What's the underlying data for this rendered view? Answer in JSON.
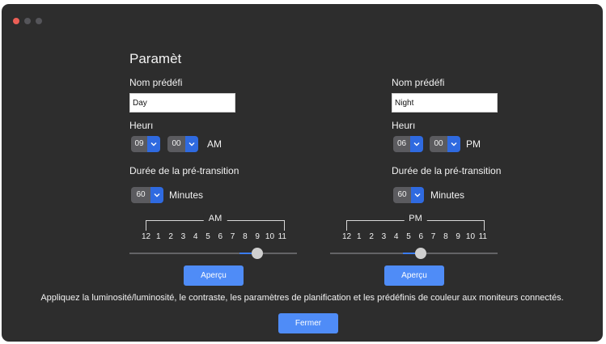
{
  "window": {
    "controls": [
      "close",
      "minimize",
      "zoom"
    ]
  },
  "title": "Paramèt",
  "left": {
    "preset_label": "Nom prédéfi",
    "preset_value": "Day",
    "time_label": "Heurı",
    "hour": "09",
    "minute": "00",
    "ampm": "AM",
    "pre_label": "Durée de la pré-transition",
    "pre_value": "60",
    "pre_unit": "Minutes",
    "scale_label": "AM",
    "ticks": [
      "12",
      "1",
      "2",
      "3",
      "4",
      "5",
      "6",
      "7",
      "8",
      "9",
      "10",
      "11"
    ],
    "slider_value": 9,
    "preview": "Aperçu"
  },
  "right": {
    "preset_label": "Nom prédéfi",
    "preset_value": "Night",
    "time_label": "Heurı",
    "hour": "06",
    "minute": "00",
    "ampm": "PM",
    "pre_label": "Durée de la pré-transition",
    "pre_value": "60",
    "pre_unit": "Minutes",
    "scale_label": "PM",
    "ticks": [
      "12",
      "1",
      "2",
      "3",
      "4",
      "5",
      "6",
      "7",
      "8",
      "9",
      "10",
      "11"
    ],
    "slider_value": 6,
    "preview": "Aperçu"
  },
  "description": "Appliquez la luminosité/luminosité, le contraste, les paramètres de planification et les prédéfinis de couleur aux moniteurs connectés.",
  "close_button": "Fermer",
  "colors": {
    "accent": "#4f8cf7",
    "background": "#2d2d2d",
    "close_dot": "#ec5f56"
  }
}
